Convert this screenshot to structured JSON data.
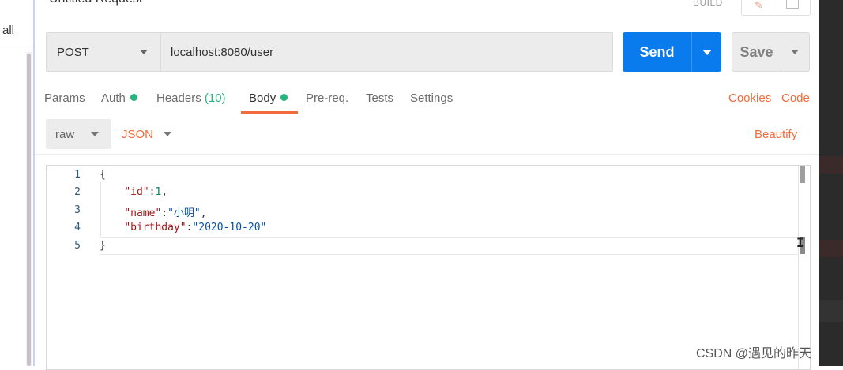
{
  "sidebar": {
    "all_label": "all"
  },
  "request": {
    "title": "Untitled Request",
    "build_label": "BUILD",
    "method": "POST",
    "url": "localhost:8080/user",
    "send_label": "Send",
    "save_label": "Save"
  },
  "tabs": [
    {
      "label": "Params"
    },
    {
      "label": "Auth"
    },
    {
      "label": "Headers",
      "count": "(10)"
    },
    {
      "label": "Body"
    },
    {
      "label": "Pre-req."
    },
    {
      "label": "Tests"
    },
    {
      "label": "Settings"
    }
  ],
  "links": {
    "cookies": "Cookies",
    "code": "Code"
  },
  "body_options": {
    "type": "raw",
    "language": "JSON",
    "beautify": "Beautify"
  },
  "editor": {
    "line_numbers": [
      "1",
      "2",
      "3",
      "4",
      "5"
    ],
    "brace_open": "{",
    "brace_close": "}",
    "fields": [
      {
        "key": "\"id\"",
        "sep": ":",
        "value": "1",
        "trail": ","
      },
      {
        "key": "\"name\"",
        "sep": ":",
        "value": "\"小明\"",
        "trail": ","
      },
      {
        "key": "\"birthday\"",
        "sep": ":",
        "value": "\"2020-10-20\"",
        "trail": ""
      }
    ]
  },
  "watermark": "CSDN @遇见的昨天",
  "colors": {
    "accent": "#f26b3a",
    "send": "#097bed",
    "dot": "#26b47f"
  }
}
